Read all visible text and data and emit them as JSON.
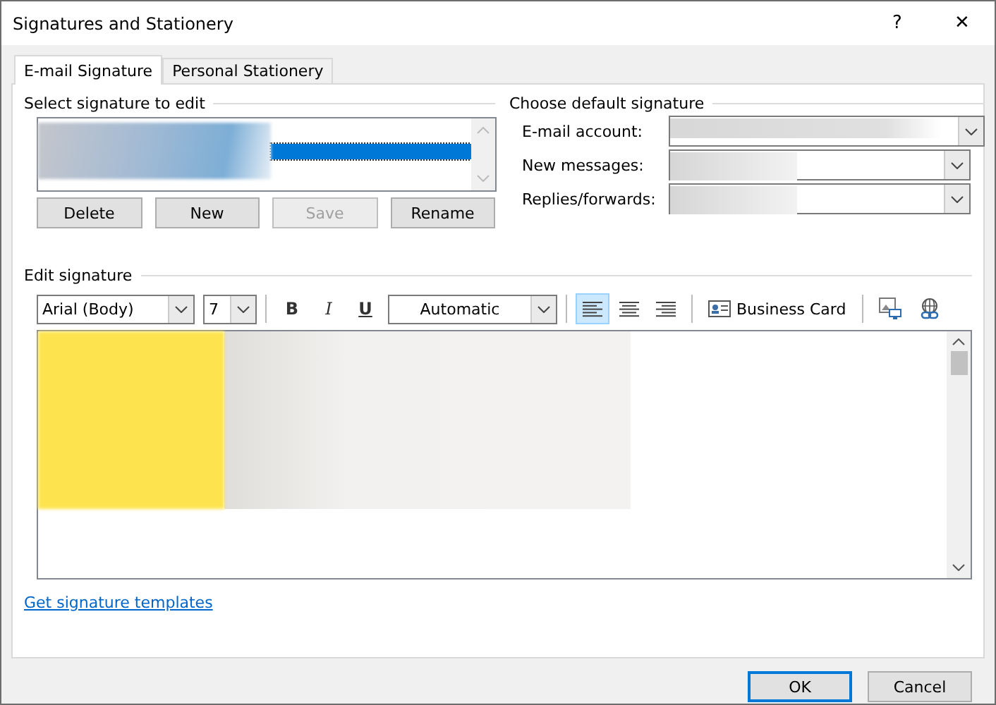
{
  "window": {
    "title": "Signatures and Stationery",
    "help": "?",
    "close": "✕"
  },
  "tabs": [
    {
      "label": "E-mail Signature",
      "selected": true
    },
    {
      "label": "Personal Stationery",
      "selected": false
    }
  ],
  "select_signature": {
    "heading": "Select signature to edit",
    "items": [
      {
        "selected": true
      }
    ],
    "buttons": [
      {
        "label": "Delete",
        "disabled": false
      },
      {
        "label": "New",
        "disabled": false
      },
      {
        "label": "Save",
        "disabled": true
      },
      {
        "label": "Rename",
        "disabled": false
      }
    ]
  },
  "default_signature": {
    "heading": "Choose default signature",
    "fields": [
      {
        "label": "E-mail account:"
      },
      {
        "label": "New messages:"
      },
      {
        "label": "Replies/forwards:"
      }
    ]
  },
  "edit_signature": {
    "heading": "Edit signature",
    "font": "Arial (Body)",
    "size": "7",
    "bold": "B",
    "italic": "I",
    "underline": "U",
    "font_color": "Automatic",
    "align": [
      {
        "kind": "left",
        "selected": true
      },
      {
        "kind": "center",
        "selected": false
      },
      {
        "kind": "right",
        "selected": false
      }
    ],
    "business_card": "Business Card"
  },
  "link": "Get signature templates",
  "buttons": [
    {
      "label": "OK",
      "default": true
    },
    {
      "label": "Cancel",
      "default": false
    }
  ]
}
